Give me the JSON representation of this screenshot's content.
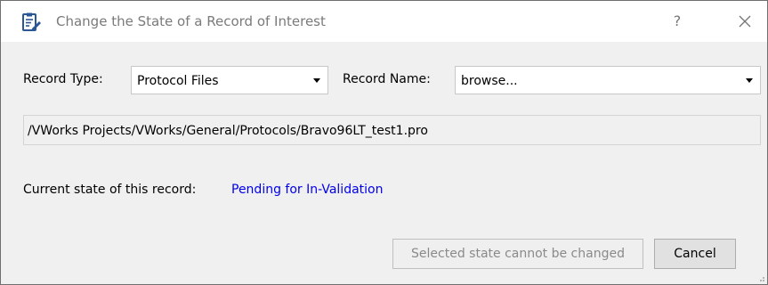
{
  "dialog": {
    "title": "Change the State of a Record of Interest",
    "help_glyph": "?",
    "close_icon": "close-icon",
    "title_icon": "clipboard-edit-icon"
  },
  "form": {
    "record_type_label": "Record Type:",
    "record_type_value": "Protocol Files",
    "record_name_label": "Record Name:",
    "record_name_value": "browse...",
    "path_value": "/VWorks Projects/VWorks/General/Protocols/Bravo96LT_test1.pro",
    "current_state_label": "Current state of this record:",
    "current_state_value": "Pending for In-Validation"
  },
  "buttons": {
    "change_state_label": "Selected state cannot be changed",
    "cancel_label": "Cancel"
  },
  "colors": {
    "state_link": "#0000ee",
    "title_icon_accent": "#2b5797",
    "disabled_text": "#8a8a8a"
  }
}
